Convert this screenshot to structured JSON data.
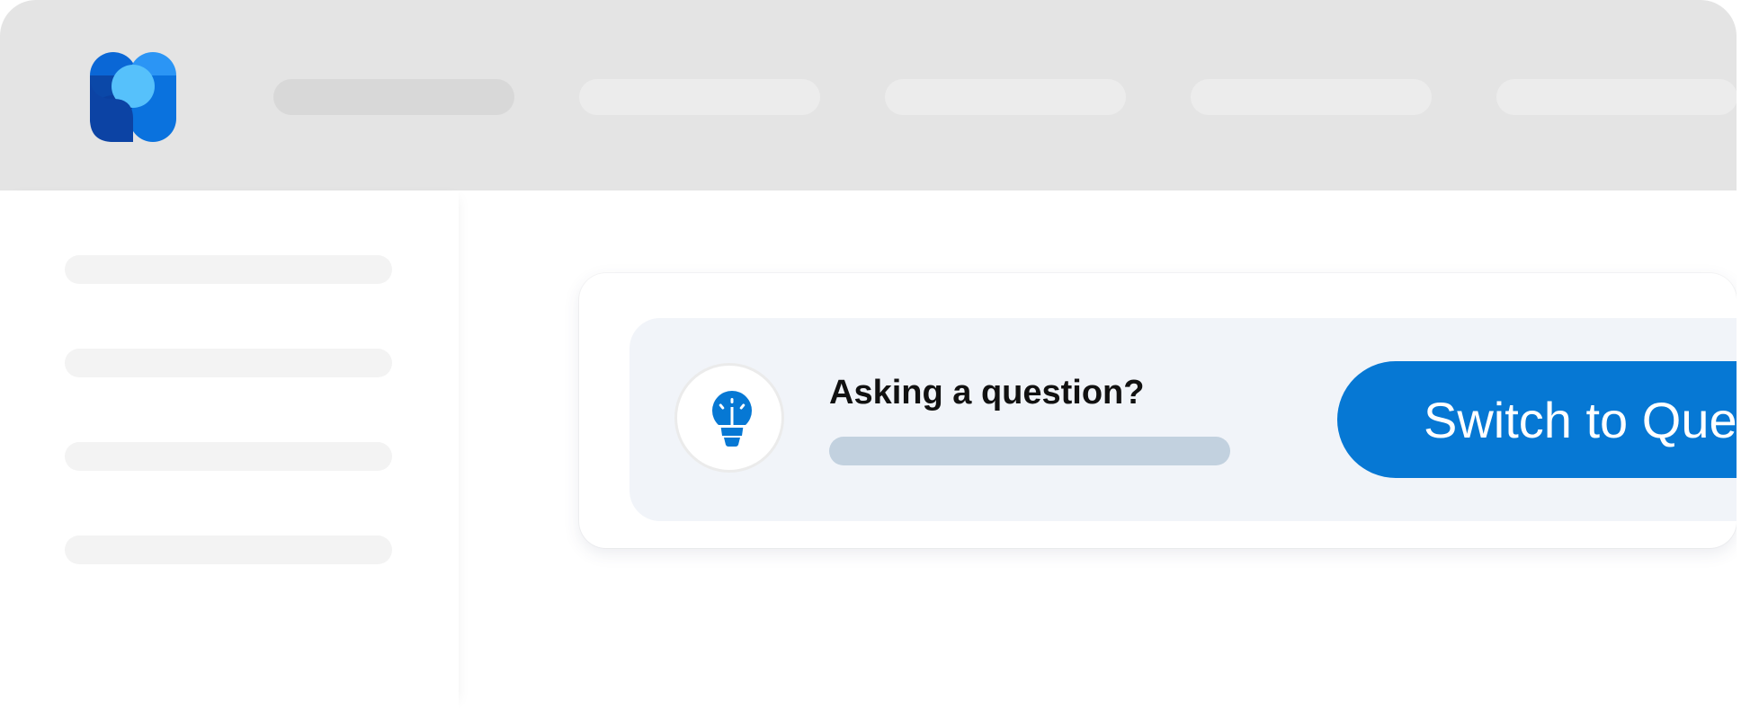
{
  "banner": {
    "title": "Asking a question?",
    "button_label": "Switch to Question",
    "icon": "lightbulb-icon"
  },
  "app": {
    "logo": "app-logo"
  },
  "colors": {
    "accent": "#0678d4",
    "topbar": "#e4e4e4",
    "banner_bg": "#f1f4f9"
  }
}
